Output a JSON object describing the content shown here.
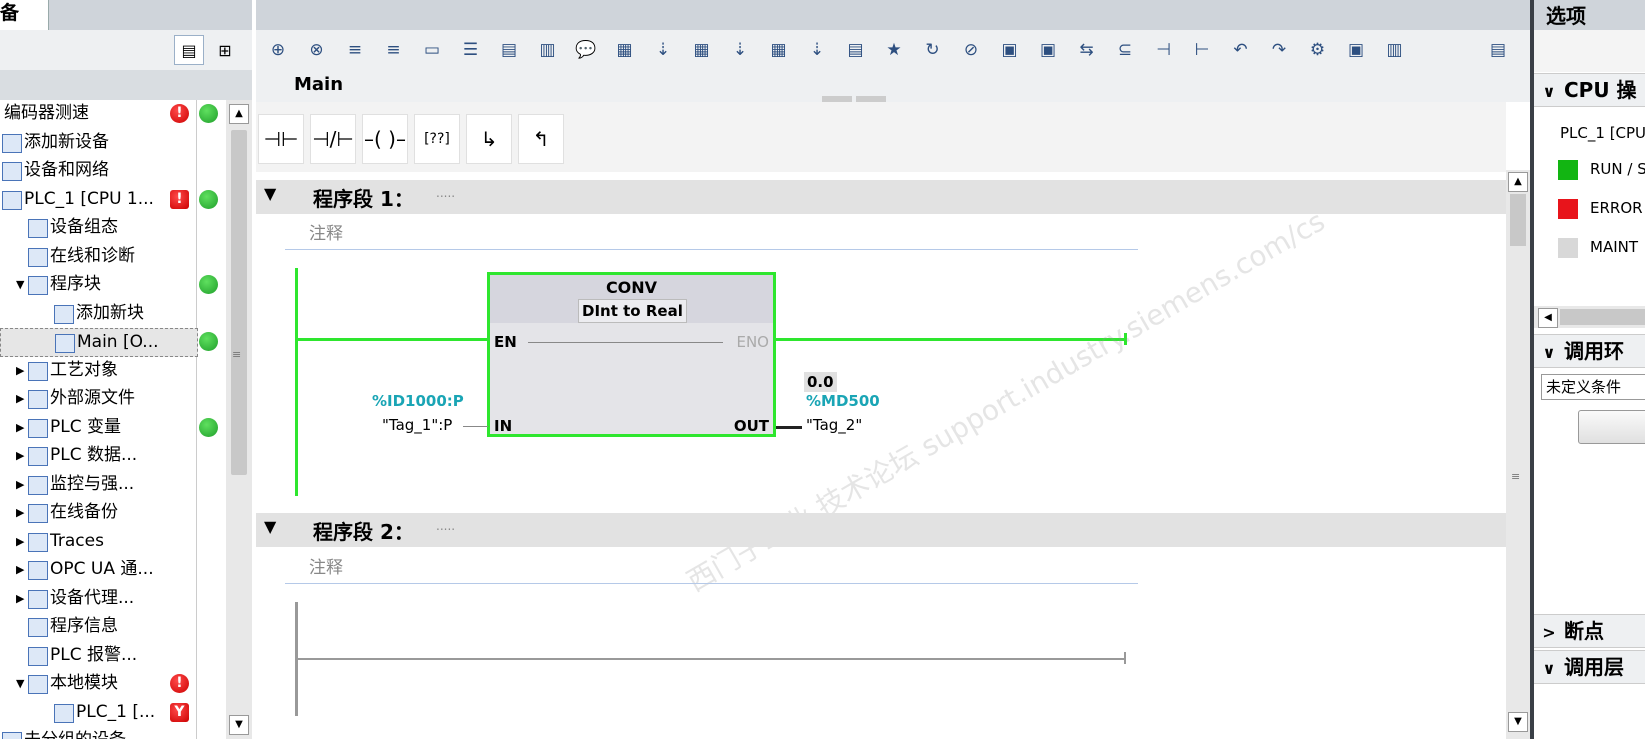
{
  "left_pane": {
    "tab_label": "备",
    "header_label": "",
    "tree": [
      {
        "label": "编码器测速",
        "status": [
          "error",
          "ok"
        ]
      },
      {
        "label": "添加新设备",
        "status": []
      },
      {
        "label": "设备和网络",
        "status": []
      },
      {
        "label": "PLC_1 [CPU 1...",
        "status": [
          "diag",
          "ok"
        ]
      },
      {
        "label": "设备组态",
        "status": []
      },
      {
        "label": "在线和诊断",
        "status": []
      },
      {
        "label": "程序块",
        "status": [
          "ok"
        ]
      },
      {
        "label": "添加新块",
        "status": []
      },
      {
        "label": "Main [O...",
        "status": [
          "ok"
        ]
      },
      {
        "label": "工艺对象",
        "status": []
      },
      {
        "label": "外部源文件",
        "status": []
      },
      {
        "label": "PLC 变量",
        "status": [
          "ok"
        ]
      },
      {
        "label": "PLC 数据...",
        "status": []
      },
      {
        "label": "监控与强...",
        "status": []
      },
      {
        "label": "在线备份",
        "status": []
      },
      {
        "label": "Traces",
        "status": []
      },
      {
        "label": "OPC UA 通...",
        "status": []
      },
      {
        "label": "设备代理...",
        "status": []
      },
      {
        "label": "程序信息",
        "status": []
      },
      {
        "label": "PLC 报警...",
        "status": []
      },
      {
        "label": "本地模块",
        "status": [
          "error"
        ]
      },
      {
        "label": "PLC_1 [...",
        "status": [
          "fault"
        ]
      },
      {
        "label": "未分组的设备",
        "status": []
      }
    ]
  },
  "editor": {
    "block_title": "Main",
    "networks": [
      {
        "title": "程序段 1：",
        "dots": ".....",
        "comment": "注释"
      },
      {
        "title": "程序段 2：",
        "dots": ".....",
        "comment": "注释"
      }
    ],
    "conv_block": {
      "name": "CONV",
      "from_type": "DInt",
      "to_word": "to",
      "to_type": "Real",
      "pin_en": "EN",
      "pin_eno": "ENO",
      "pin_in": "IN",
      "pin_out": "OUT",
      "in_address": "%ID1000:P",
      "in_tag": "\"Tag_1\":P",
      "out_value": "0.0",
      "out_address": "%MD500",
      "out_tag": "\"Tag_2\""
    },
    "watermark": "西门子工业 技术论坛 support.industry.siemens.com/cs"
  },
  "right_pane": {
    "header": "选项",
    "section_cpu": "CPU 操",
    "plc_label": "PLC_1 [CPU",
    "leds": [
      {
        "label": "RUN / S",
        "color": "#12b512"
      },
      {
        "label": "ERROR",
        "color": "#e8141b"
      },
      {
        "label": "MAINT",
        "color": "#d8d8d8"
      }
    ],
    "section_call_env": "调用环",
    "dropdown_value": "未定义条件",
    "section_breakpoints": "断点",
    "section_call_hierarchy": "调用层",
    "bottom_text": "..."
  }
}
